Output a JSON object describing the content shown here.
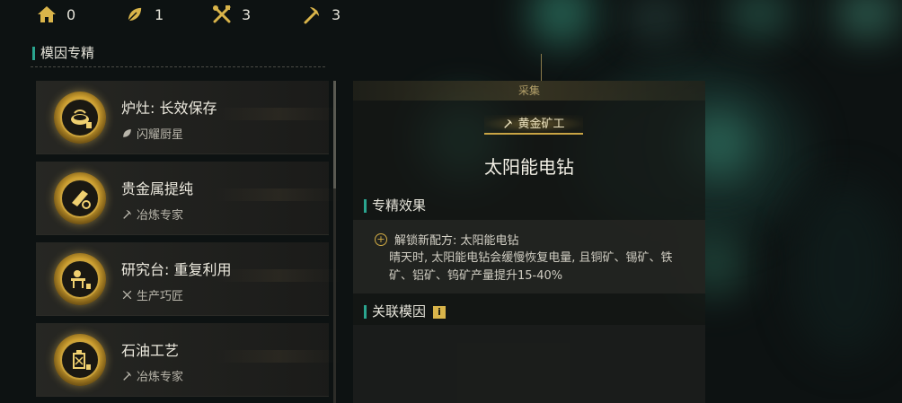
{
  "resources": [
    {
      "icon": "house-icon",
      "count": "0"
    },
    {
      "icon": "leaf-icon",
      "count": "1"
    },
    {
      "icon": "tools-icon",
      "count": "3"
    },
    {
      "icon": "pickaxe-icon",
      "count": "3"
    }
  ],
  "left": {
    "section_title": "模因专精",
    "cards": [
      {
        "icon": "stove-icon",
        "title": "炉灶: 长效保存",
        "sub_icon": "leaf-icon",
        "sub": "闪耀厨星"
      },
      {
        "icon": "gold-bar-icon",
        "title": "贵金属提纯",
        "sub_icon": "pickaxe-icon",
        "sub": "冶炼专家"
      },
      {
        "icon": "workbench-icon",
        "title": "研究台: 重复利用",
        "sub_icon": "tools-icon",
        "sub": "生产巧匠"
      },
      {
        "icon": "oil-can-icon",
        "title": "石油工艺",
        "sub_icon": "pickaxe-icon",
        "sub": "冶炼专家"
      }
    ]
  },
  "detail": {
    "category": "采集",
    "rank": "黄金矿工",
    "skill_name": "太阳能电钻",
    "effect_title": "专精效果",
    "effect_line": "解锁新配方: 太阳能电钻",
    "effect_desc": "晴天时, 太阳能电钻会缓慢恢复电量, 且铜矿、锡矿、铁矿、铝矿、钨矿产量提升15-40%",
    "linked_title": "关联模因",
    "linked_info": "i"
  },
  "colors": {
    "accent_teal": "#2aa58f",
    "gold": "#d3ad45"
  }
}
